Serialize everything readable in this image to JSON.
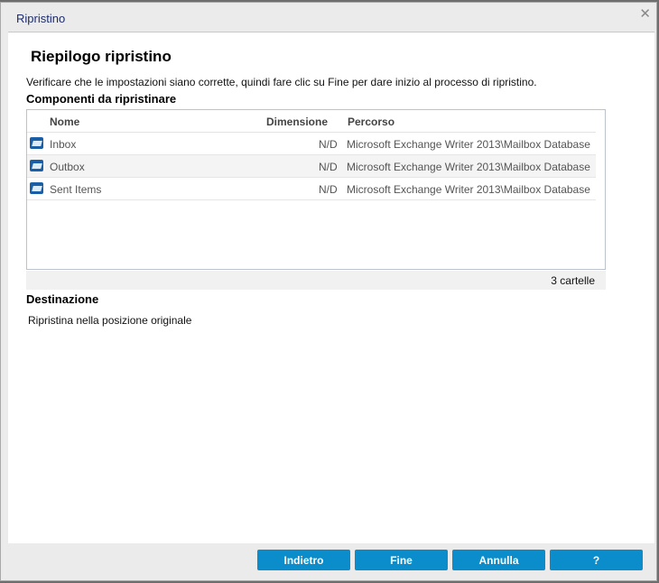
{
  "window": {
    "title": "Ripristino",
    "close": "✕"
  },
  "heading": "Riepilogo ripristino",
  "description": "Verificare che le impostazioni siano corrette, quindi fare clic su Fine per dare inizio al processo di ripristino.",
  "components": {
    "label": "Componenti da ripristinare",
    "columns": [
      "Nome",
      "Dimensione",
      "Percorso"
    ],
    "rows": [
      {
        "name": "Inbox",
        "size": "N/D",
        "path": "Microsoft Exchange Writer 2013\\Mailbox Database"
      },
      {
        "name": "Outbox",
        "size": "N/D",
        "path": "Microsoft Exchange Writer 2013\\Mailbox Database"
      },
      {
        "name": "Sent Items",
        "size": "N/D",
        "path": "Microsoft Exchange Writer 2013\\Mailbox Database"
      }
    ],
    "count": "3 cartelle"
  },
  "destination": {
    "label": "Destinazione",
    "value": "Ripristina nella posizione originale"
  },
  "buttons": {
    "back": "Indietro",
    "finish": "Fine",
    "cancel": "Annulla",
    "help": "?"
  }
}
